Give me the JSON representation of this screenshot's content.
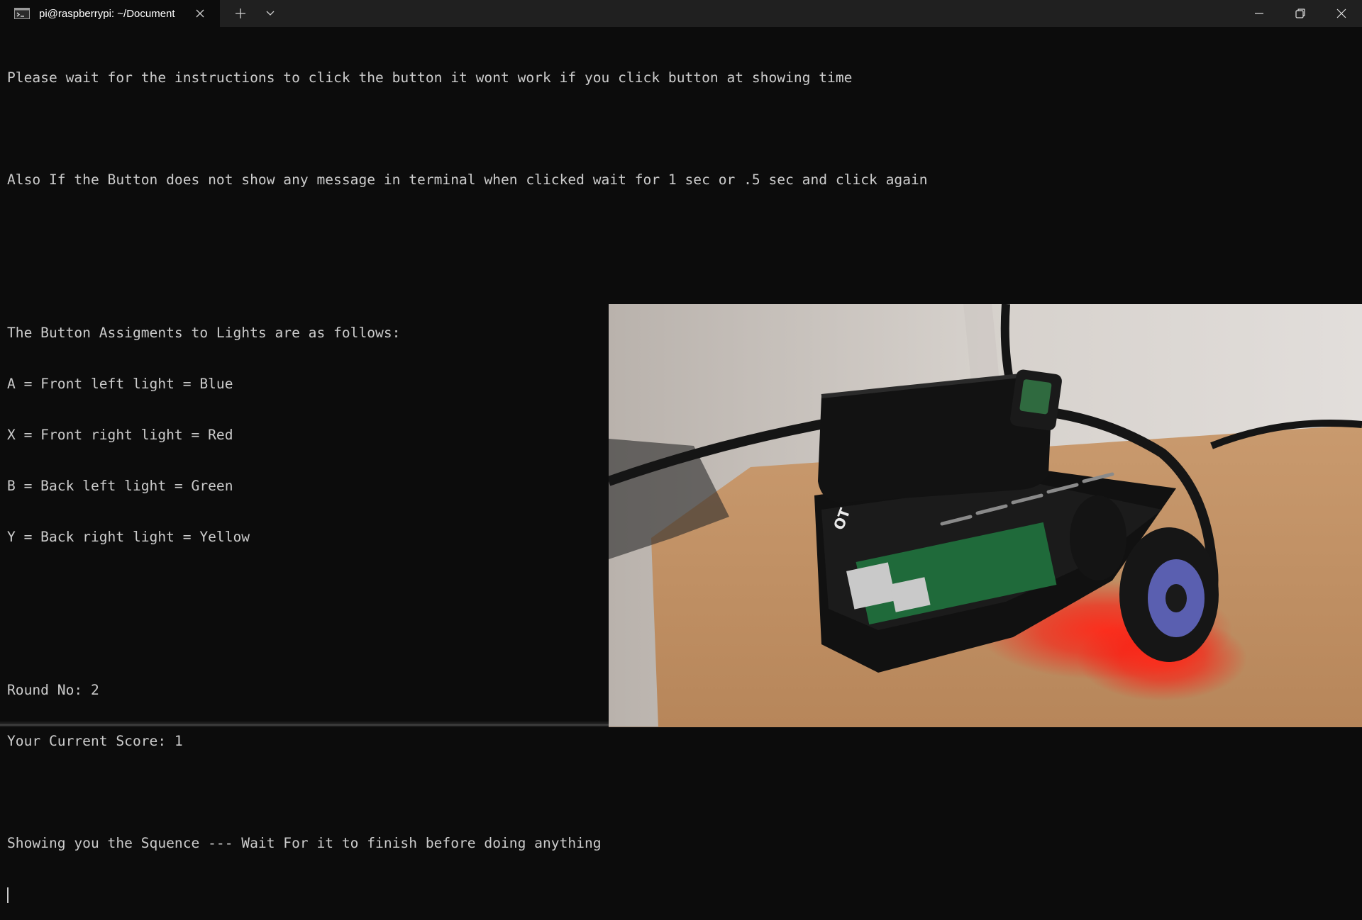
{
  "titlebar": {
    "tab_title": "pi@raspberrypi: ~/Document",
    "icons": [
      "terminal-icon",
      "close-icon",
      "plus-icon",
      "chevron-down-icon",
      "minimize-icon",
      "restore-icon",
      "close-window-icon"
    ]
  },
  "terminal": {
    "lines": [
      "Please wait for the instructions to click the button it wont work if you click button at showing time",
      "",
      "Also If the Button does not show any message in terminal when clicked wait for 1 sec or .5 sec and click again",
      "",
      "",
      "The Button Assigments to Lights are as follows:",
      "A = Front left light = Blue",
      "X = Front right light = Red",
      "B = Back left light = Green",
      "Y = Back right light = Yellow",
      "",
      "",
      "Round No: 2",
      "Your Current Score: 1",
      "",
      "Showing you the Squence --- Wait For it to finish before doing anything"
    ]
  },
  "colors": {
    "background": "#0c0c0c",
    "text": "#cccccc",
    "titlebar": "#202020"
  }
}
